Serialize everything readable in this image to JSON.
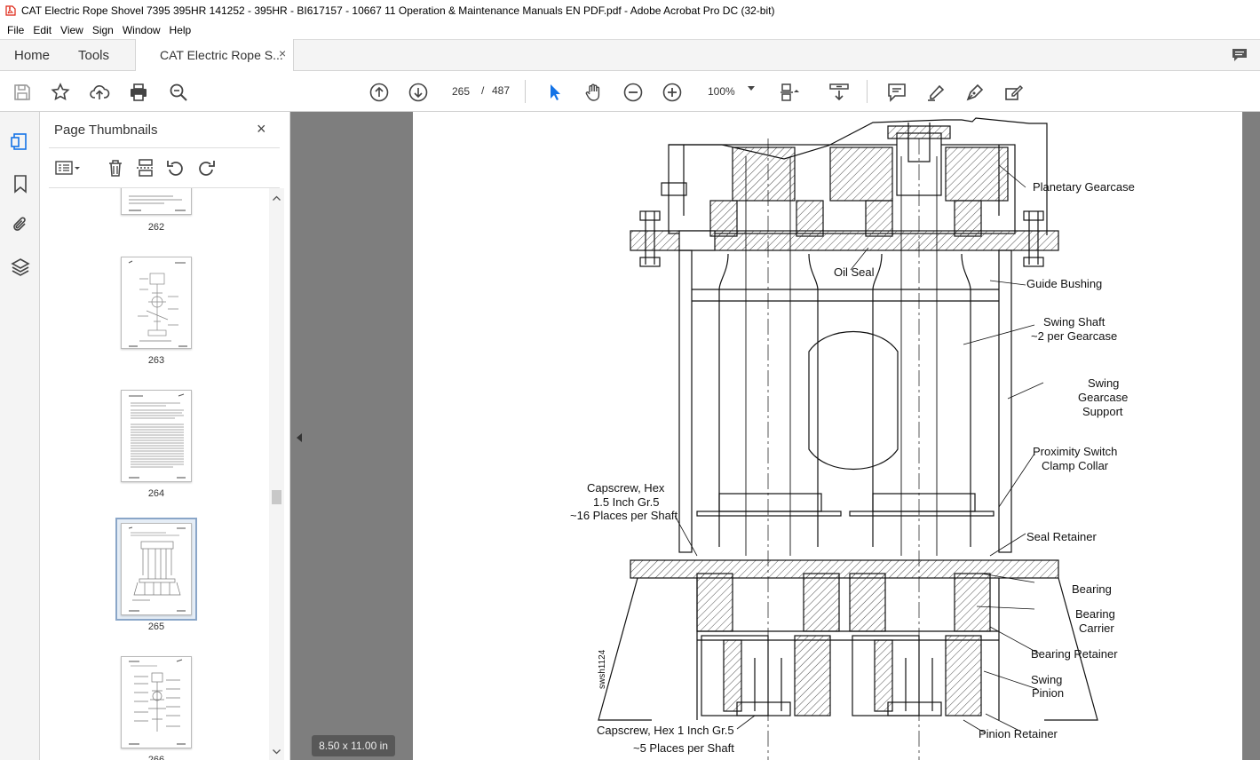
{
  "window": {
    "title": "CAT Electric Rope Shovel 7395 395HR 141252 - 395HR - BI617157 - 10667 11 Operation & Maintenance Manuals EN PDF.pdf - Adobe Acrobat Pro DC (32-bit)"
  },
  "menu": [
    "File",
    "Edit",
    "View",
    "Sign",
    "Window",
    "Help"
  ],
  "tabs": {
    "home": "Home",
    "tools": "Tools",
    "doc": "CAT Electric Rope S...",
    "doc_close": "×"
  },
  "toolbar": {
    "page_current": "265",
    "page_sep": "/",
    "page_total": "487",
    "zoom": "100%"
  },
  "thumbpanel": {
    "title": "Page Thumbnails",
    "close": "×",
    "thumbnails": [
      {
        "label": "262"
      },
      {
        "label": "263"
      },
      {
        "label": "264"
      },
      {
        "label": "265"
      },
      {
        "label": "266"
      }
    ]
  },
  "document": {
    "page_size": "8.50 x 11.00 in",
    "drawing_id": "swsh1124",
    "labels": {
      "planetary_gearcase": "Planetary Gearcase",
      "oil_seal": "Oil Seal",
      "guide_bushing": "Guide Bushing",
      "swing_shaft_1": "Swing Shaft",
      "swing_shaft_2": "~2 per Gearcase",
      "swing_gearcase_support_1": "Swing",
      "swing_gearcase_support_2": "Gearcase",
      "swing_gearcase_support_3": "Support",
      "proximity_switch_1": "Proximity Switch",
      "proximity_switch_2": "Clamp Collar",
      "capscrew_15_1": "Capscrew, Hex",
      "capscrew_15_2": "1.5 Inch Gr.5",
      "capscrew_15_3": "~16 Places per Shaft",
      "seal_retainer": "Seal Retainer",
      "bearing": "Bearing",
      "bearing_carrier_1": "Bearing",
      "bearing_carrier_2": "Carrier",
      "bearing_retainer": "Bearing Retainer",
      "swing_pinion_1": "Swing",
      "swing_pinion_2": "Pinion",
      "capscrew_1_1": "Capscrew, Hex 1 Inch Gr.5",
      "capscrew_1_2": "~5 Places per Shaft",
      "pinion_retainer": "Pinion Retainer"
    }
  }
}
